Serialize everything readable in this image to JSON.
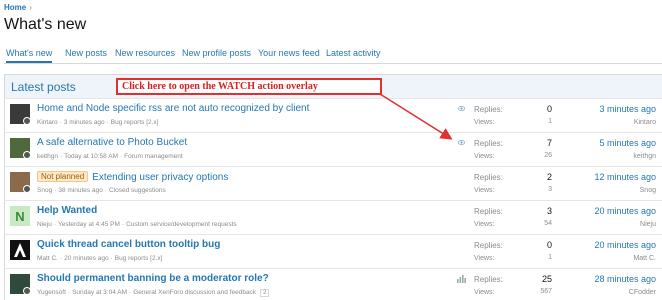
{
  "breadcrumb": {
    "home": "Home",
    "separator": "›"
  },
  "page_title": "What's new",
  "tabs": [
    "What's new",
    "New posts",
    "New resources",
    "New profile posts",
    "Your news feed",
    "Latest activity"
  ],
  "block_title": "Latest posts",
  "annotation": "Click here to open the WATCH action overlay",
  "labels": {
    "replies": "Replies:",
    "views": "Views:"
  },
  "threads": [
    {
      "prefix": "",
      "title": "Home and Node specific rss are not auto recognized by client",
      "author": "Kintaro",
      "date": "3 minutes ago",
      "forum": "Bug reports [2.x]",
      "pages": "",
      "replies": "0",
      "views": "1",
      "last_time": "3 minutes ago",
      "last_user": "Kintaro",
      "icon": "eye-icon",
      "avatar_color": "#3a3a3a"
    },
    {
      "prefix": "",
      "title": "A safe alternative to Photo Bucket",
      "author": "keithgn",
      "date": "Today at 10:58 AM",
      "forum": "Forum management",
      "pages": "",
      "replies": "7",
      "views": "26",
      "last_time": "5 minutes ago",
      "last_user": "keithgn",
      "icon": "eye-icon",
      "avatar_color": "#4e6a3a"
    },
    {
      "prefix": "Not planned",
      "title": "Extending user privacy options",
      "author": "Snog",
      "date": "38 minutes ago",
      "forum": "Closed suggestions",
      "pages": "",
      "replies": "2",
      "views": "3",
      "last_time": "12 minutes ago",
      "last_user": "Snog",
      "icon": "",
      "avatar_color": "#8a6a4a"
    },
    {
      "prefix": "",
      "title": "Help Wanted",
      "author": "Nieju",
      "date": "Yesterday at 4:45 PM",
      "forum": "Custom service/development requests",
      "pages": "",
      "replies": "3",
      "views": "54",
      "last_time": "20 minutes ago",
      "last_user": "Nieju",
      "icon": "",
      "avatar_letter": "N",
      "avatar_color": "#c9e8c4",
      "avatar_text_color": "#3d8a37"
    },
    {
      "prefix": "",
      "title": "Quick thread cancel button tooltip bug",
      "author": "Matt C.",
      "date": "20 minutes ago",
      "forum": "Bug reports [2.x]",
      "pages": "",
      "replies": "0",
      "views": "1",
      "last_time": "20 minutes ago",
      "last_user": "Matt C.",
      "icon": "",
      "avatar_color": "#111111"
    },
    {
      "prefix": "",
      "title": "Should permanent banning be a moderator role?",
      "author": "Yugensoft",
      "date": "Sunday at 3:04 AM",
      "forum": "General XenForo discussion and feedback",
      "pages": "2",
      "replies": "25",
      "views": "567",
      "last_time": "28 minutes ago",
      "last_user": "CFodder",
      "icon": "bar-graph-icon",
      "avatar_color": "#2f4a3a"
    }
  ]
}
